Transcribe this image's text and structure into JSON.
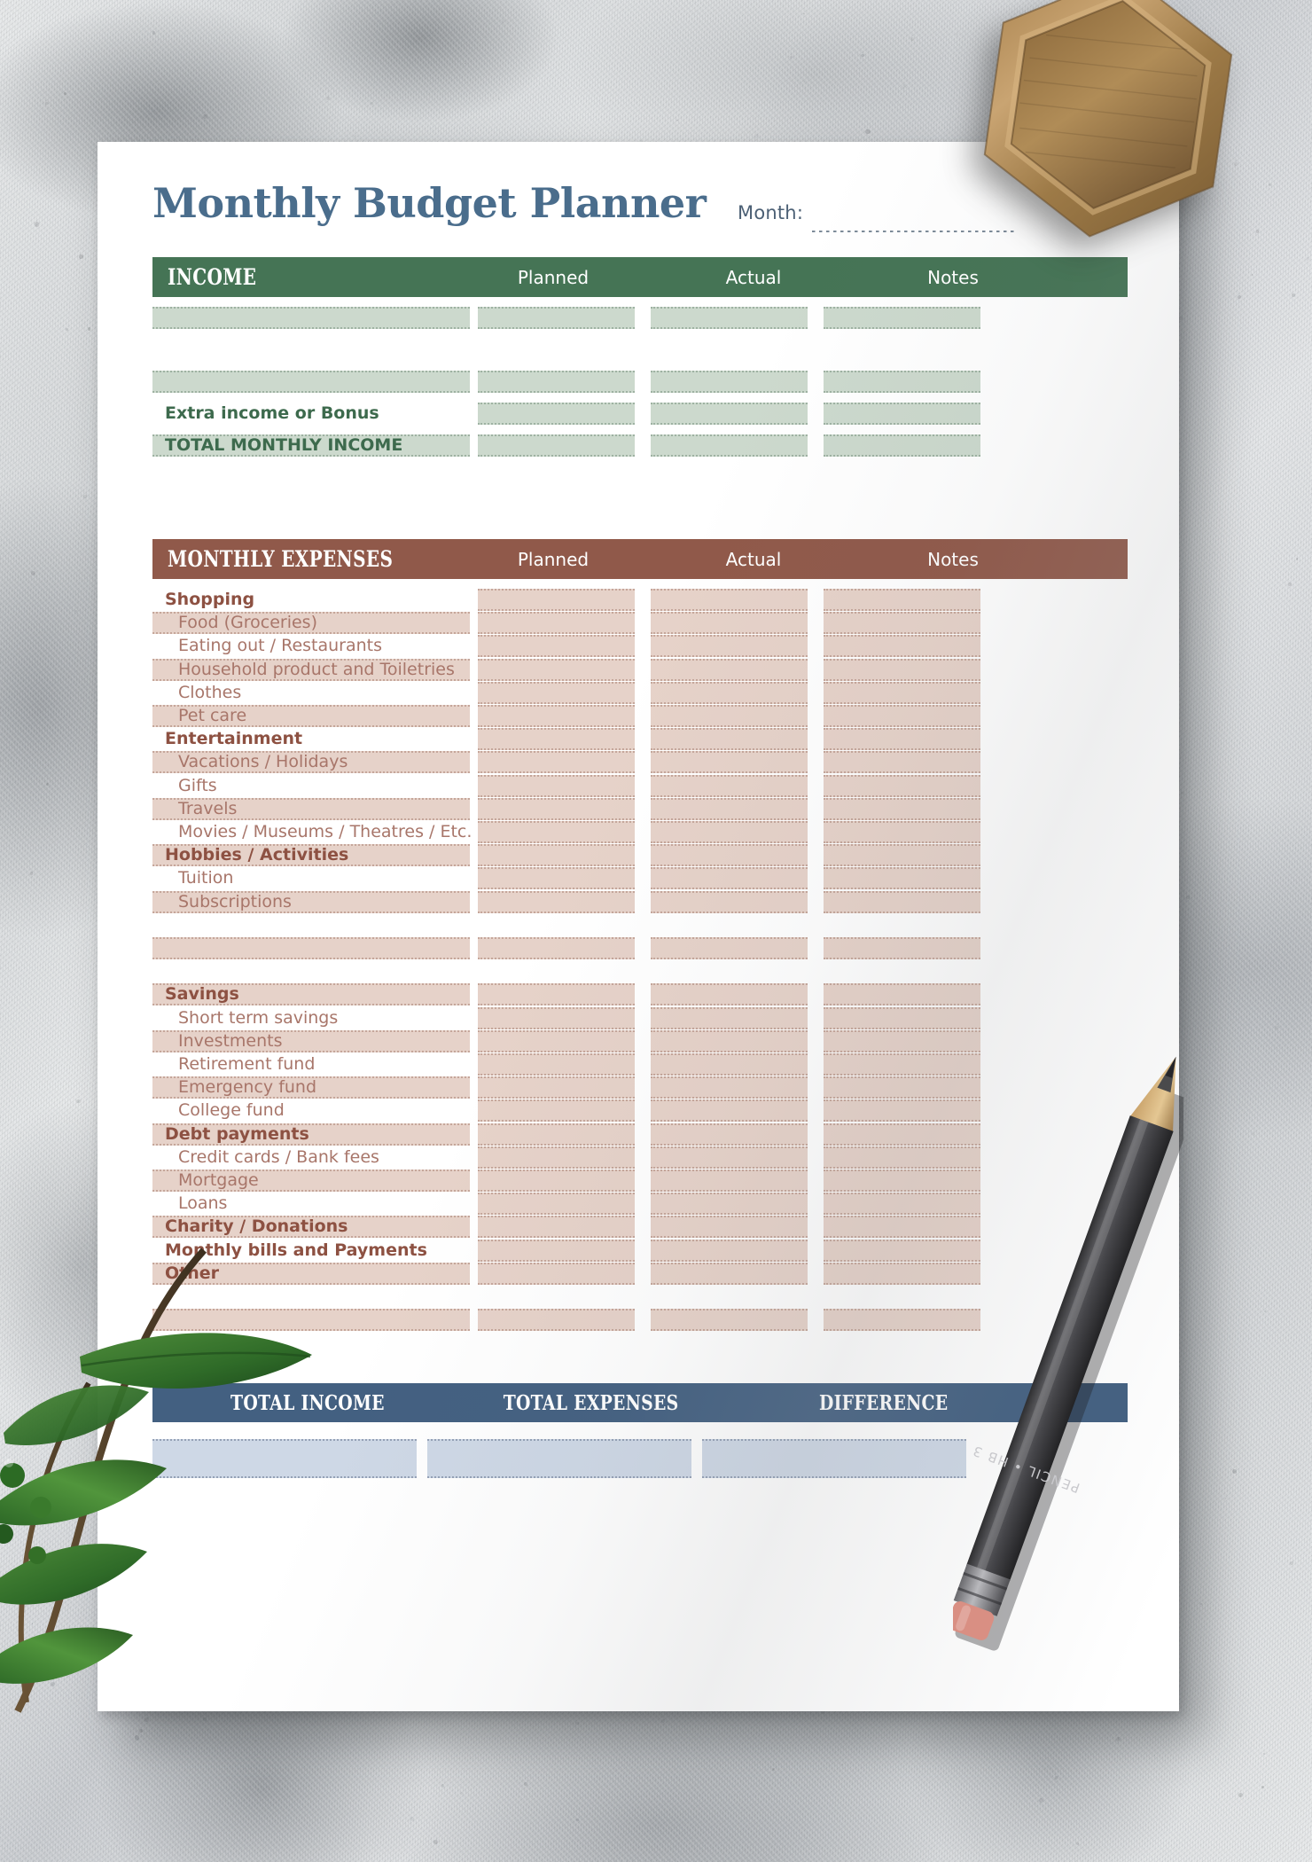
{
  "document": {
    "title": "Monthly Budget Planner",
    "month_field": {
      "label": "Month:",
      "value": ""
    }
  },
  "income": {
    "header": {
      "title": "INCOME",
      "col_planned": "Planned",
      "col_actual": "Actual",
      "col_notes": "Notes"
    },
    "rows": [
      {
        "label": "",
        "type": "blank_filled"
      },
      {
        "label": "",
        "type": "spacer"
      },
      {
        "label": "",
        "type": "blank_filled"
      },
      {
        "label": "Extra income or Bonus",
        "type": "heading_nofill"
      },
      {
        "label": "TOTAL MONTHLY INCOME",
        "type": "total"
      }
    ]
  },
  "expenses": {
    "header": {
      "title": "MONTHLY EXPENSES",
      "col_planned": "Planned",
      "col_actual": "Actual",
      "col_notes": "Notes"
    },
    "rows": [
      {
        "label": "Shopping",
        "type": "heading_nofill"
      },
      {
        "label": "Food (Groceries)",
        "type": "item_fill"
      },
      {
        "label": "Eating out / Restaurants",
        "type": "item_nofill"
      },
      {
        "label": "Household product and Toiletries",
        "type": "item_fill"
      },
      {
        "label": "Clothes",
        "type": "item_nofill"
      },
      {
        "label": "Pet care",
        "type": "item_fill"
      },
      {
        "label": "Entertainment",
        "type": "heading_nofill"
      },
      {
        "label": "Vacations / Holidays",
        "type": "item_fill"
      },
      {
        "label": "Gifts",
        "type": "item_nofill"
      },
      {
        "label": "Travels",
        "type": "item_fill"
      },
      {
        "label": "Movies / Museums / Theatres / Etc.",
        "type": "item_nofill"
      },
      {
        "label": "Hobbies / Activities",
        "type": "heading_fill"
      },
      {
        "label": "Tuition",
        "type": "item_nofill"
      },
      {
        "label": "Subscriptions",
        "type": "item_fill"
      },
      {
        "label": "",
        "type": "spacer"
      },
      {
        "label": "",
        "type": "blank_filled"
      },
      {
        "label": "",
        "type": "spacer"
      },
      {
        "label": "Savings",
        "type": "heading_fill"
      },
      {
        "label": "Short term savings",
        "type": "item_nofill"
      },
      {
        "label": "Investments",
        "type": "item_fill"
      },
      {
        "label": "Retirement fund",
        "type": "item_nofill"
      },
      {
        "label": "Emergency fund",
        "type": "item_fill"
      },
      {
        "label": "College fund",
        "type": "item_nofill"
      },
      {
        "label": "Debt payments",
        "type": "heading_fill"
      },
      {
        "label": "Credit cards / Bank fees",
        "type": "item_nofill"
      },
      {
        "label": "Mortgage",
        "type": "item_fill"
      },
      {
        "label": "Loans",
        "type": "item_nofill"
      },
      {
        "label": "Charity / Donations",
        "type": "heading_fill"
      },
      {
        "label": "Monthly bills and Payments",
        "type": "heading_nofill"
      },
      {
        "label": "Other",
        "type": "heading_fill"
      },
      {
        "label": "",
        "type": "spacer"
      },
      {
        "label": "",
        "type": "blank_filled"
      }
    ]
  },
  "totals": {
    "income_label": "TOTAL INCOME",
    "expenses_label": "TOTAL EXPENSES",
    "difference_label": "DIFFERENCE",
    "income_value": "",
    "expenses_value": "",
    "difference_value": ""
  },
  "objects": {
    "coaster": "wooden-hexagon-coaster",
    "pencil": "graphite-pencil",
    "pencil_text": "PENCIL • HB 3",
    "leaves": "green-leaves-plant",
    "surface": "marble-concrete-surface"
  },
  "colors": {
    "title_blue": "#4a6d8c",
    "income_green": "#457455",
    "income_fill": "#ccd9cd",
    "expenses_brown": "#90594a",
    "expenses_fill": "#e6d2c9",
    "totals_blue": "#436081",
    "totals_fill": "#ced8e6",
    "paper": "#ffffff"
  }
}
